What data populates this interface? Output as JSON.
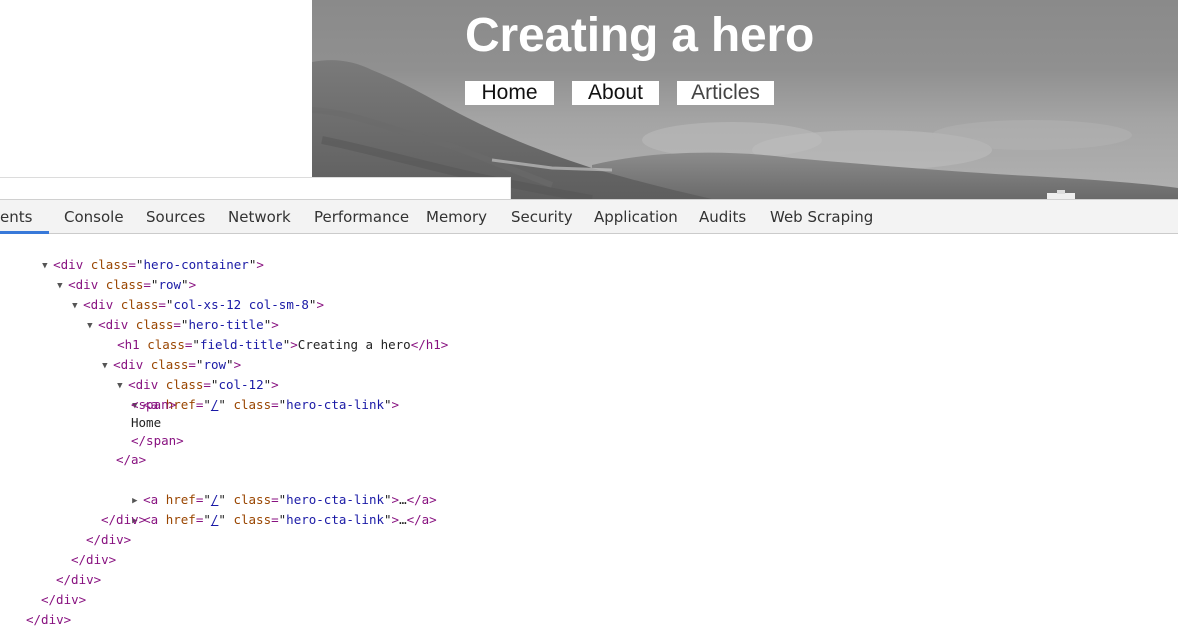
{
  "hero": {
    "title": "Creating a hero",
    "links": [
      "Home",
      "About",
      "Articles"
    ]
  },
  "devtools": {
    "tabs": [
      "ents",
      "Console",
      "Sources",
      "Network",
      "Performance",
      "Memory",
      "Security",
      "Application",
      "Audits",
      "Web Scraping"
    ],
    "active_tab": "ents",
    "accent_color": "#3879d9"
  },
  "dom": {
    "l1": {
      "tag": "div",
      "attr": "class",
      "val": "hero-container"
    },
    "l2": {
      "tag": "div",
      "attr": "class",
      "val": "row"
    },
    "l3": {
      "tag": "div",
      "attr": "class",
      "val": "col-xs-12 col-sm-8"
    },
    "l4": {
      "tag": "div",
      "attr": "class",
      "val": "hero-title"
    },
    "l5": {
      "tag": "h1",
      "attr": "class",
      "val": "field-title",
      "text": "Creating a hero",
      "close": "</h1>"
    },
    "l6": {
      "tag": "div",
      "attr": "class",
      "val": "row"
    },
    "l7": {
      "tag": "div",
      "attr": "class",
      "val": "col-12"
    },
    "l8": {
      "tag": "a",
      "href_attr": "href",
      "href": "/",
      "attr": "class",
      "val": "hero-cta-link"
    },
    "l9": {
      "open": "<span>"
    },
    "l10": {
      "text": "Home"
    },
    "l11": {
      "close": "</span>"
    },
    "l12": {
      "close": "</a>"
    },
    "l13": {
      "tag": "a",
      "href_attr": "href",
      "href": "/",
      "attr": "class",
      "val": "hero-cta-link",
      "ellipsis": "…",
      "close": "</a>"
    },
    "l14": {
      "tag": "a",
      "href_attr": "href",
      "href": "/",
      "attr": "class",
      "val": "hero-cta-link",
      "ellipsis": "…",
      "close": "</a>"
    },
    "l15": {
      "close": "</div>"
    },
    "l16": {
      "close": "</div>"
    },
    "l17": {
      "close": "</div>"
    },
    "l18": {
      "close": "</div>"
    },
    "l19": {
      "close": "</div>"
    },
    "l20": {
      "close": "</div>"
    }
  }
}
